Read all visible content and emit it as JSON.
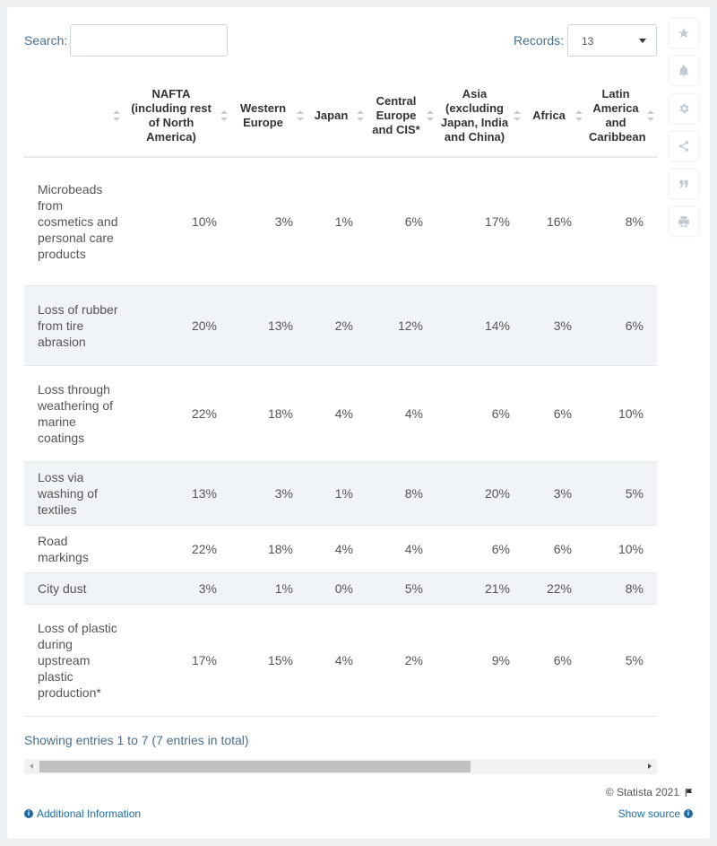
{
  "search": {
    "label": "Search:",
    "value": ""
  },
  "records": {
    "label": "Records:",
    "value": "13"
  },
  "table": {
    "columns": [
      "",
      "NAFTA (including rest of North America)",
      "Western Europe",
      "Japan",
      "Central Europe and CIS*",
      "Asia (excluding Japan, India and China)",
      "Africa",
      "Latin America and Caribbean"
    ],
    "rows": [
      {
        "label": "Microbeads from cosmetics and personal care products",
        "values": [
          "10%",
          "3%",
          "1%",
          "6%",
          "17%",
          "16%",
          "8%"
        ]
      },
      {
        "label": "Loss of rubber from tire abrasion",
        "values": [
          "20%",
          "13%",
          "2%",
          "12%",
          "14%",
          "3%",
          "6%"
        ]
      },
      {
        "label": "Loss through weathering of marine coatings",
        "values": [
          "22%",
          "18%",
          "4%",
          "4%",
          "6%",
          "6%",
          "10%"
        ]
      },
      {
        "label": "Loss via washing of textiles",
        "values": [
          "13%",
          "3%",
          "1%",
          "8%",
          "20%",
          "3%",
          "5%"
        ]
      },
      {
        "label": "Road markings",
        "values": [
          "22%",
          "18%",
          "4%",
          "4%",
          "6%",
          "6%",
          "10%"
        ]
      },
      {
        "label": "City dust",
        "values": [
          "3%",
          "1%",
          "0%",
          "5%",
          "21%",
          "22%",
          "8%"
        ]
      },
      {
        "label": "Loss of plastic during upstream plastic production*",
        "values": [
          "17%",
          "15%",
          "4%",
          "2%",
          "9%",
          "6%",
          "5%"
        ]
      }
    ]
  },
  "footer": {
    "entries_text": "Showing entries 1 to 7 (7 entries in total)",
    "copyright": "© Statista 2021",
    "additional_info": "Additional Information",
    "show_source": "Show source"
  },
  "side_buttons": [
    "star-icon",
    "bell-icon",
    "gear-icon",
    "share-icon",
    "quote-icon",
    "print-icon"
  ],
  "colors": {
    "link": "#1f6ba5",
    "row_alt": "#f1f4f7"
  }
}
